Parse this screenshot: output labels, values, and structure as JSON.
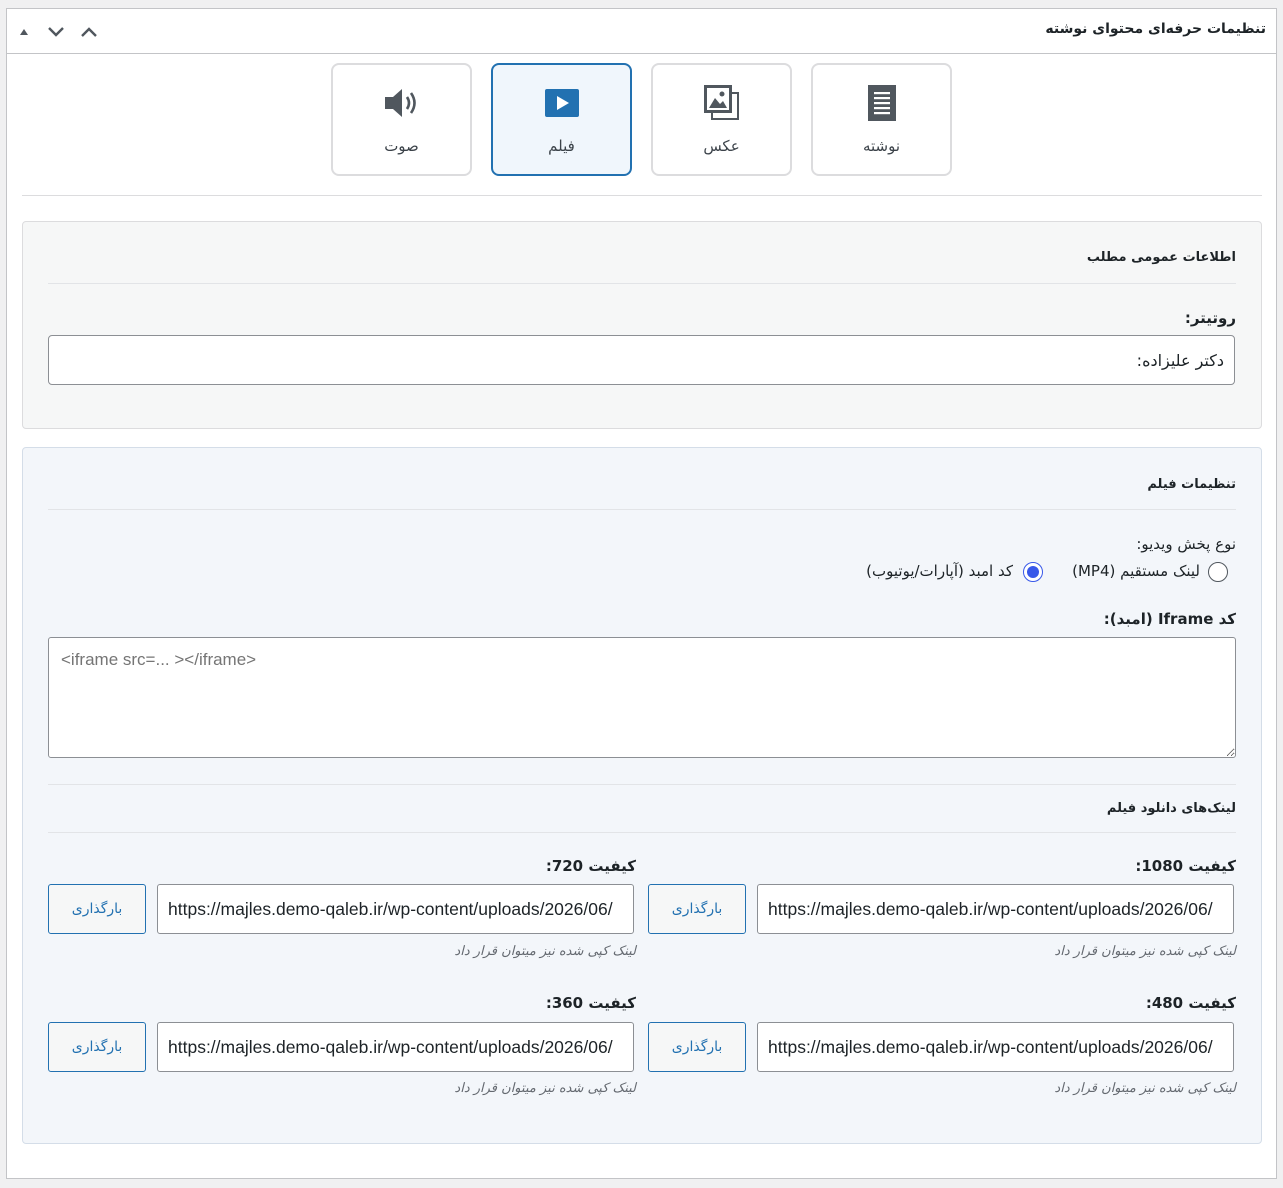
{
  "metabox": {
    "title": "تنظیمات حرفه‌ای محتوای نوشته",
    "controls": [
      "move-up",
      "move-down",
      "collapse"
    ]
  },
  "post_types": [
    {
      "label": "نوشته",
      "icon": "document-icon",
      "active": false
    },
    {
      "label": "عکس",
      "icon": "gallery-icon",
      "active": false
    },
    {
      "label": "فیلم",
      "icon": "video-icon",
      "active": true
    },
    {
      "label": "صوت",
      "icon": "audio-icon",
      "active": false
    }
  ],
  "general": {
    "title": "اطلاعات عمومی مطلب",
    "rotitr_label": "روتیتر:",
    "rotitr_value": "دکتر علیزاده:"
  },
  "video": {
    "title": "تنظیمات فیلم",
    "play_type_label": "نوع پخش ویدیو:",
    "options": [
      {
        "label": "لینک مستقیم (MP4)",
        "checked": false
      },
      {
        "label": "کد امبد (آپارات/یوتیوب)",
        "checked": true
      }
    ],
    "iframe_label": "کد Iframe (امبد):",
    "iframe_placeholder": "<iframe src=... ></iframe>",
    "downloads_title": "لینک‌های دانلود فیلم",
    "qualities": [
      {
        "label": "کیفیت 1080:",
        "url": "https://majles.demo-qaleb.ir/wp-content/uploads/2026/06/",
        "button": "بارگذاری",
        "hint": "لینک کپی شده نیز میتوان قرار داد"
      },
      {
        "label": "کیفیت 720:",
        "url": "https://majles.demo-qaleb.ir/wp-content/uploads/2026/06/",
        "button": "بارگذاری",
        "hint": "لینک کپی شده نیز میتوان قرار داد"
      },
      {
        "label": "کیفیت 480:",
        "url": "https://majles.demo-qaleb.ir/wp-content/uploads/2026/06/",
        "button": "بارگذاری",
        "hint": "لینک کپی شده نیز میتوان قرار داد"
      },
      {
        "label": "کیفیت 360:",
        "url": "https://majles.demo-qaleb.ir/wp-content/uploads/2026/06/",
        "button": "بارگذاری",
        "hint": "لینک کپی شده نیز میتوان قرار داد"
      }
    ]
  },
  "colors": {
    "accent": "#2271b1",
    "radio": "#3858e9",
    "active_card_bg": "#f0f6fc"
  }
}
